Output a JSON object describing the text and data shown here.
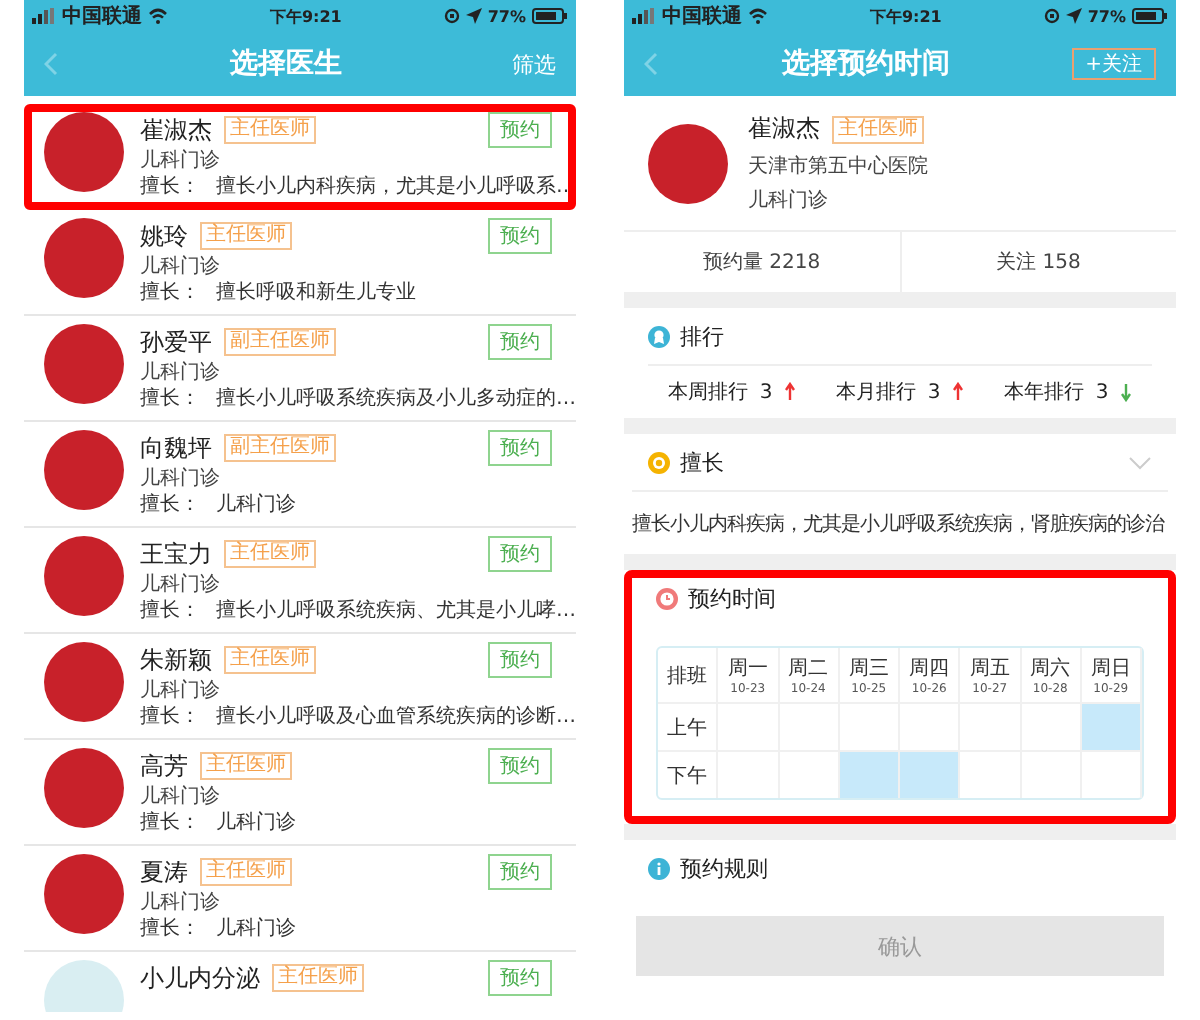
{
  "screens": [
    {
      "status_bar": {
        "carrier": "中国联通",
        "time": "下午9:21",
        "battery": "77%"
      },
      "header": {
        "title": "选择医生",
        "action": "筛选"
      },
      "doctors": [
        {
          "name": "崔淑杰",
          "title": "主任医师",
          "dept": "儿科门诊",
          "specialty_label": "擅长：",
          "specialty": "擅长小儿内科疾病，尤其是小儿呼吸系…",
          "button": "预约",
          "highlighted": true
        },
        {
          "name": "姚玲",
          "title": "主任医师",
          "dept": "儿科门诊",
          "specialty_label": "擅长：",
          "specialty": "擅长呼吸和新生儿专业",
          "button": "预约",
          "highlighted": false
        },
        {
          "name": "孙爱平",
          "title": "副主任医师",
          "dept": "儿科门诊",
          "specialty_label": "擅长：",
          "specialty": "擅长小儿呼吸系统疾病及小儿多动症的…",
          "button": "预约",
          "highlighted": false
        },
        {
          "name": "向魏坪",
          "title": "副主任医师",
          "dept": "儿科门诊",
          "specialty_label": "擅长：",
          "specialty": "儿科门诊",
          "button": "预约",
          "highlighted": false
        },
        {
          "name": "王宝力",
          "title": "主任医师",
          "dept": "儿科门诊",
          "specialty_label": "擅长：",
          "specialty": "擅长小儿呼吸系统疾病、尤其是小儿哮…",
          "button": "预约",
          "highlighted": false
        },
        {
          "name": "朱新颖",
          "title": "主任医师",
          "dept": "儿科门诊",
          "specialty_label": "擅长：",
          "specialty": "擅长小儿呼吸及心血管系统疾病的诊断…",
          "button": "预约",
          "highlighted": false
        },
        {
          "name": "高芳",
          "title": "主任医师",
          "dept": "儿科门诊",
          "specialty_label": "擅长：",
          "specialty": "儿科门诊",
          "button": "预约",
          "highlighted": false
        },
        {
          "name": "夏涛",
          "title": "主任医师",
          "dept": "儿科门诊",
          "specialty_label": "擅长：",
          "specialty": "儿科门诊",
          "button": "预约",
          "highlighted": false
        },
        {
          "name": "小儿内分泌",
          "title": "主任医师",
          "button": "预约",
          "highlighted": false
        }
      ]
    },
    {
      "status_bar": {
        "carrier": "中国联通",
        "time": "下午9:21",
        "battery": "77%"
      },
      "header": {
        "title": "选择预约时间",
        "action": "+关注"
      },
      "doctor": {
        "name": "崔淑杰",
        "title": "主任医师",
        "hospital": "天津市第五中心医院",
        "dept": "儿科门诊"
      },
      "stats": [
        "预约量 2218",
        "关注 158"
      ],
      "ranking": {
        "title": "排行",
        "items": [
          {
            "label": "本周排行",
            "value": "3",
            "rising": true
          },
          {
            "label": "本月排行",
            "value": "3",
            "rising": true
          },
          {
            "label": "本年排行",
            "value": "3",
            "rising": false
          }
        ]
      },
      "specialty": {
        "title": "擅长",
        "text": "擅长小儿内科疾病，尤其是小儿呼吸系统疾病，肾脏疾病的诊治",
        "expanded": false
      },
      "schedule": {
        "title": "预约时间",
        "highlighted": true,
        "corner": "排班",
        "days": [
          {
            "day": "周一",
            "date": "10-23"
          },
          {
            "day": "周二",
            "date": "10-24"
          },
          {
            "day": "周三",
            "date": "10-25"
          },
          {
            "day": "周四",
            "date": "10-26"
          },
          {
            "day": "周五",
            "date": "10-27"
          },
          {
            "day": "周六",
            "date": "10-28"
          },
          {
            "day": "周日",
            "date": "10-29"
          }
        ],
        "rows": [
          {
            "label": "上午",
            "slots": [
              {
                "selected": false
              },
              {
                "selected": false
              },
              {
                "selected": false
              },
              {
                "selected": false
              },
              {
                "selected": false
              },
              {
                "selected": false
              },
              {
                "selected": true
              }
            ]
          },
          {
            "label": "下午",
            "slots": [
              {
                "selected": false
              },
              {
                "selected": false
              },
              {
                "selected": true
              },
              {
                "selected": true
              },
              {
                "selected": false
              },
              {
                "selected": false
              },
              {
                "selected": false
              }
            ]
          }
        ]
      },
      "rules": {
        "title": "预约规则"
      },
      "confirm": {
        "label": "确认",
        "disabled": true
      }
    }
  ]
}
